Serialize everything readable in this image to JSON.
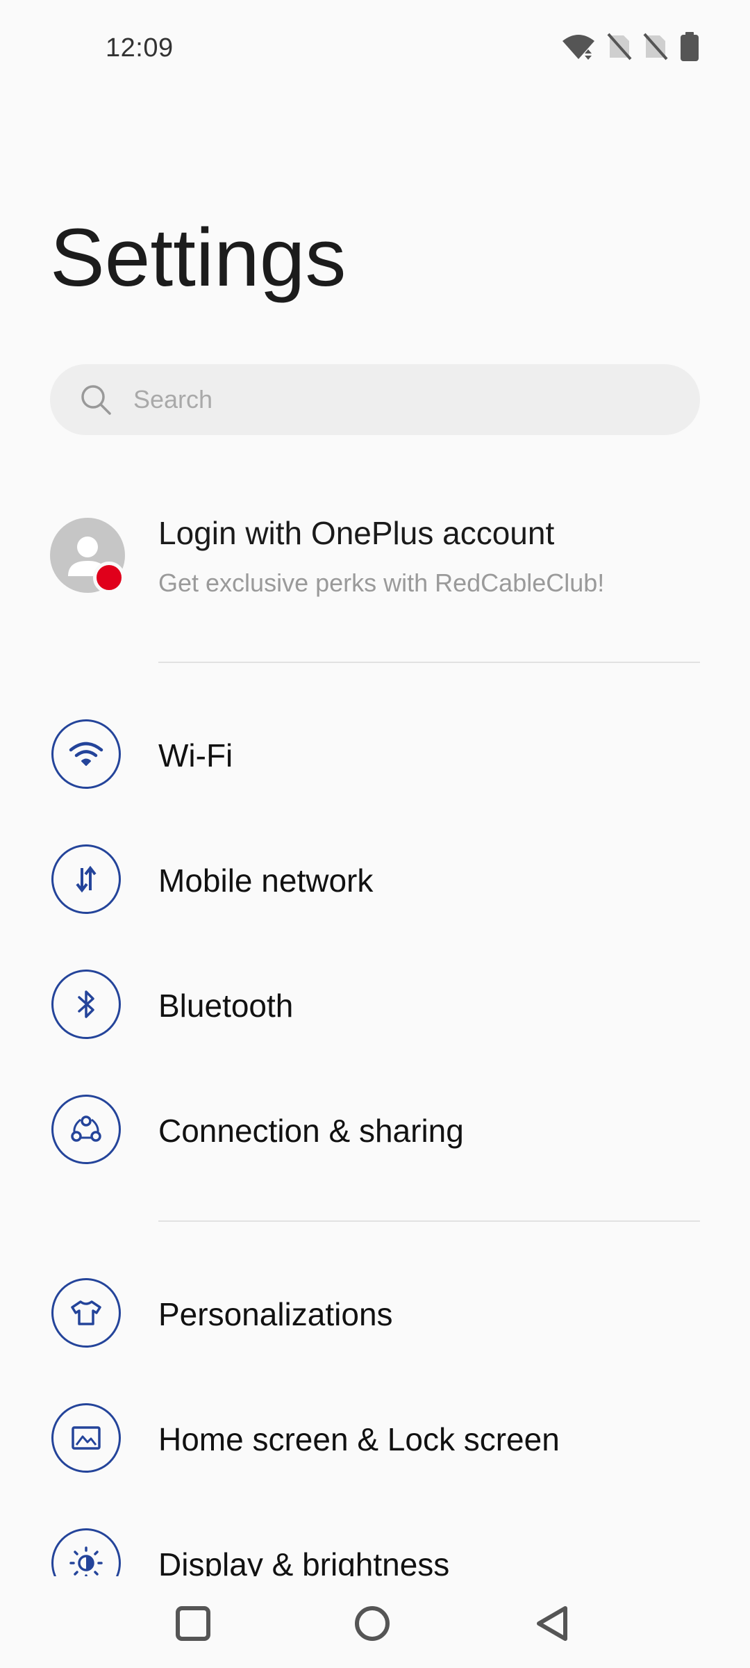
{
  "status_bar": {
    "time": "12:09"
  },
  "title": "Settings",
  "search": {
    "placeholder": "Search",
    "value": ""
  },
  "account": {
    "title": "Login with OnePlus account",
    "subtitle": "Get exclusive perks with RedCableClub!"
  },
  "groups": [
    [
      {
        "label": "Wi-Fi",
        "icon": "wifi-icon"
      },
      {
        "label": "Mobile network",
        "icon": "mobile-data-icon"
      },
      {
        "label": "Bluetooth",
        "icon": "bluetooth-icon"
      },
      {
        "label": "Connection & sharing",
        "icon": "connection-sharing-icon"
      }
    ],
    [
      {
        "label": "Personalizations",
        "icon": "tshirt-icon"
      },
      {
        "label": "Home screen & Lock screen",
        "icon": "picture-icon"
      },
      {
        "label": "Display & brightness",
        "icon": "brightness-icon"
      }
    ]
  ],
  "colors": {
    "icon_accent": "#24449a",
    "badge": "#e0001b"
  }
}
